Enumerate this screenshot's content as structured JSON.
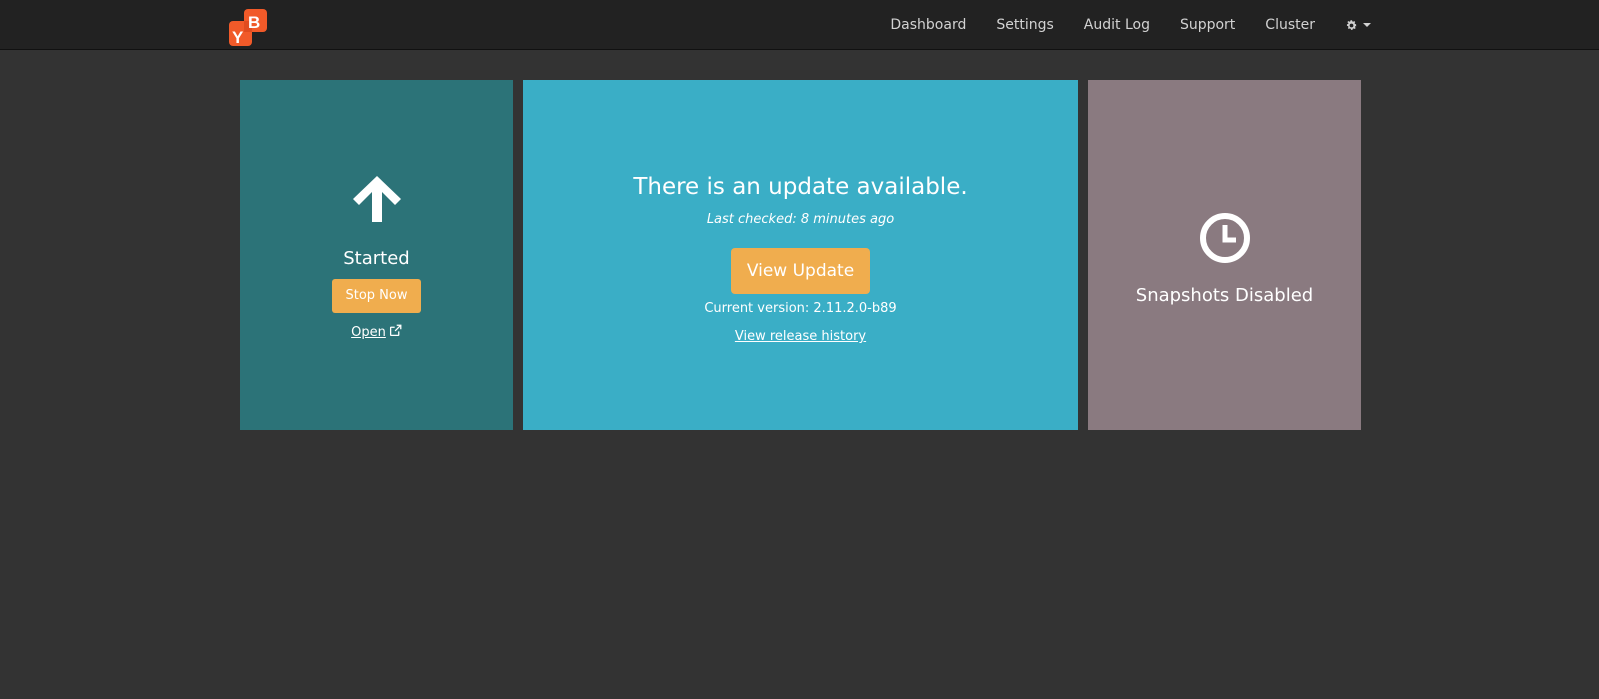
{
  "header": {
    "logo_text": "YB",
    "logo_color": "#f15a29",
    "nav": {
      "dashboard": "Dashboard",
      "settings": "Settings",
      "audit_log": "Audit Log",
      "support": "Support",
      "cluster": "Cluster"
    },
    "gear_icon": "gear-icon"
  },
  "app_panel": {
    "icon": "arrow-up-icon",
    "status": "Started",
    "stop_button": "Stop Now",
    "open_link": "Open",
    "color": "#2c7378"
  },
  "update_panel": {
    "title": "There is an update available.",
    "last_checked": "Last checked: 8 minutes ago",
    "view_button": "View Update",
    "current_version": "Current version: 2.11.2.0-b89",
    "release_history": "View release history",
    "color": "#3aaec6"
  },
  "snapshot_panel": {
    "icon": "clock-icon",
    "status": "Snapshots Disabled",
    "color": "#8a7a80"
  },
  "accent_color": "#f0ad4e"
}
